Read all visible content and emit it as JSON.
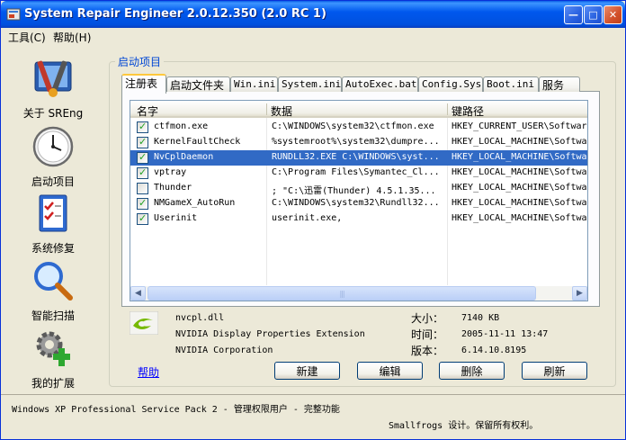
{
  "window": {
    "title": "System Repair Engineer 2.0.12.350 (2.0 RC 1)",
    "controls": {
      "minimize": "—",
      "maximize": "□",
      "close": "✕"
    }
  },
  "menu": [
    {
      "label": "工具(C)"
    },
    {
      "label": "帮助(H)"
    }
  ],
  "nav": [
    {
      "label": "关于 SREng",
      "icon": "tools-icon"
    },
    {
      "label": "启动项目",
      "icon": "clock-icon"
    },
    {
      "label": "系统修复",
      "icon": "checklist-icon"
    },
    {
      "label": "智能扫描",
      "icon": "magnifier-icon"
    },
    {
      "label": "我的扩展",
      "icon": "gear-plus-icon"
    }
  ],
  "group_title": "启动项目",
  "tabs": [
    {
      "label": "注册表",
      "active": true
    },
    {
      "label": "启动文件夹"
    },
    {
      "label": "Win.ini"
    },
    {
      "label": "System.ini"
    },
    {
      "label": "AutoExec.bat"
    },
    {
      "label": "Config.Sys"
    },
    {
      "label": "Boot.ini"
    },
    {
      "label": "服务"
    }
  ],
  "columns": [
    "名字",
    "数据",
    "键路径"
  ],
  "rows": [
    {
      "name": "ctfmon.exe",
      "data": "C:\\WINDOWS\\system32\\ctfmon.exe",
      "path": "HKEY_CURRENT_USER\\Softwar",
      "checked": true,
      "selected": false
    },
    {
      "name": "KernelFaultCheck",
      "data": "%systemroot%\\system32\\dumpre...",
      "path": "HKEY_LOCAL_MACHINE\\Softwa",
      "checked": true,
      "selected": false
    },
    {
      "name": "NvCplDaemon",
      "data": "RUNDLL32.EXE C:\\WINDOWS\\syst...",
      "path": "HKEY_LOCAL_MACHINE\\Softwa",
      "checked": true,
      "selected": true
    },
    {
      "name": "vptray",
      "data": "C:\\Program Files\\Symantec_Cl...",
      "path": "HKEY_LOCAL_MACHINE\\Softwa",
      "checked": true,
      "selected": false
    },
    {
      "name": "Thunder",
      "data": "; \"C:\\迅雷(Thunder) 4.5.1.35...",
      "path": "HKEY_LOCAL_MACHINE\\Softwa",
      "checked": false,
      "selected": false
    },
    {
      "name": "NMGameX_AutoRun",
      "data": "C:\\WINDOWS\\system32\\Rundll32...",
      "path": "HKEY_LOCAL_MACHINE\\Softwa",
      "checked": true,
      "selected": false
    },
    {
      "name": "Userinit",
      "data": "userinit.exe,",
      "path": "HKEY_LOCAL_MACHINE\\Softwa",
      "checked": true,
      "selected": false
    }
  ],
  "scroll": {
    "left": "◀",
    "right": "▶",
    "grip": "|||"
  },
  "details": {
    "file": "nvcpl.dll",
    "description": "NVIDIA Display Properties Extension",
    "company": "NVIDIA Corporation",
    "size_label": "大小：",
    "size_value": "7140 KB",
    "time_label": "时间：",
    "time_value": "2005-11-11 13:47",
    "version_label": "版本：",
    "version_value": "6.14.10.8195"
  },
  "help": "帮助",
  "buttons": {
    "new": "新建",
    "edit": "编辑",
    "delete": "删除",
    "refresh": "刷新"
  },
  "status": {
    "line1": "Windows XP Professional Service Pack 2 - 管理权限用户 - 完整功能",
    "line2": "Smallfrogs 设计。保留所有权利。"
  },
  "colors": {
    "accent": "#316AC5",
    "title_bar": "#0058EE",
    "group_title": "#0046D5",
    "check": "#21A121"
  }
}
